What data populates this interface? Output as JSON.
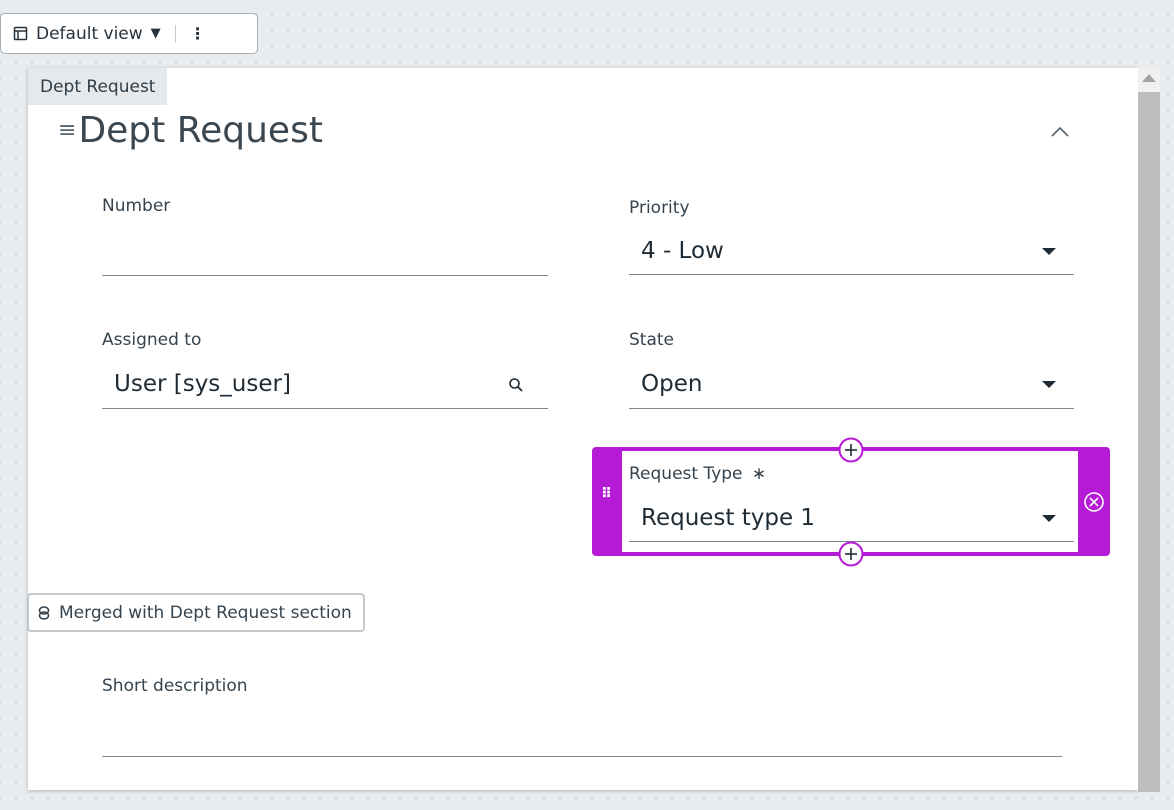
{
  "toolbar": {
    "view_label": "Default view",
    "view_icon": "view-icon",
    "menu_icon": "kebab-icon"
  },
  "form": {
    "section_tab": "Dept Request",
    "title": "Dept Request",
    "fields": {
      "number": {
        "label": "Number",
        "value": ""
      },
      "priority": {
        "label": "Priority",
        "value": "4 - Low"
      },
      "assigned_to": {
        "label": "Assigned to",
        "value": "User [sys_user]"
      },
      "state": {
        "label": "State",
        "value": "Open"
      },
      "request_type": {
        "label": "Request Type",
        "required_mark": "∗",
        "value": "Request type 1"
      },
      "short_description": {
        "label": "Short description",
        "value": ""
      }
    },
    "merged_notice": "Merged with Dept Request section"
  },
  "colors": {
    "accent": "#b51ad6",
    "text": "#2e3d49",
    "line": "#7c8891",
    "section_tab_bg": "#e6e9eb"
  }
}
